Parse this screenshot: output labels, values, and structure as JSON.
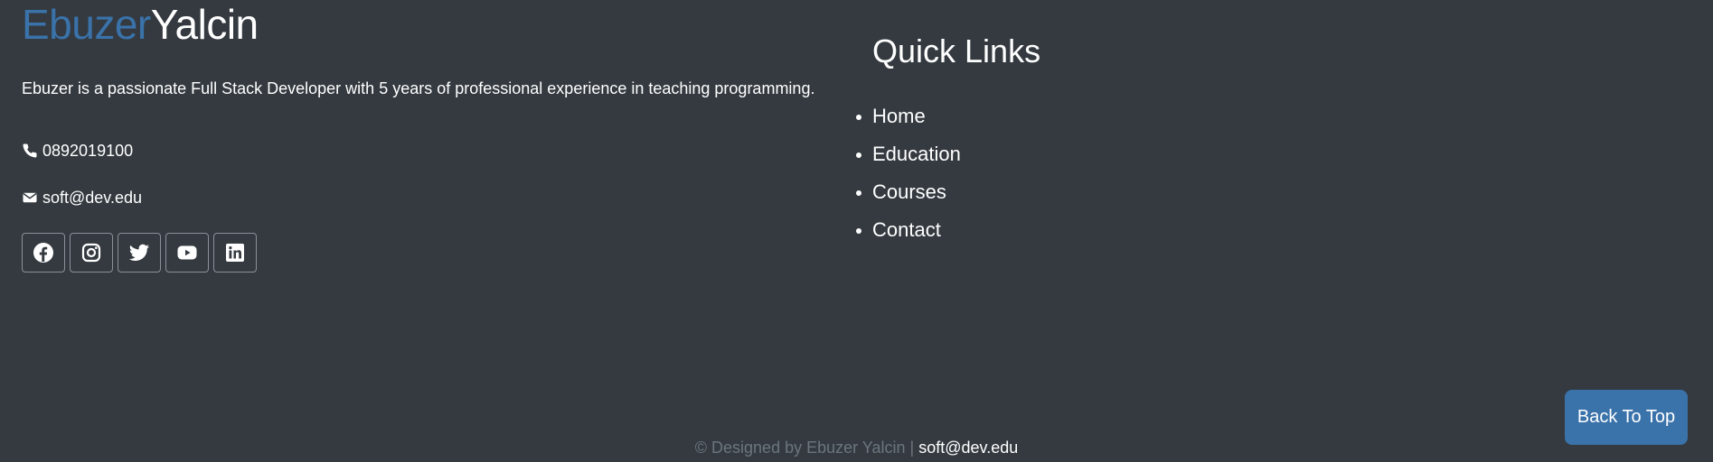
{
  "brand": {
    "first": "Ebuzer",
    "last": "Yalcin"
  },
  "about": "Ebuzer is a passionate Full Stack Developer with 5 years of professional experience in teaching programming.",
  "contact": {
    "phone": "0892019100",
    "email": "soft@dev.edu"
  },
  "socials": [
    {
      "name": "facebook-icon"
    },
    {
      "name": "instagram-icon"
    },
    {
      "name": "twitter-icon"
    },
    {
      "name": "youtube-icon"
    },
    {
      "name": "linkedin-icon"
    }
  ],
  "quick_links": {
    "title": "Quick Links",
    "items": [
      "Home",
      "Education",
      "Courses",
      "Contact"
    ]
  },
  "back_to_top": "Back To Top",
  "footer": {
    "credit": "© Designed by Ebuzer Yalcin",
    "separator": "|",
    "email": "soft@dev.edu"
  },
  "colors": {
    "background": "#343a40",
    "accent": "#3a72aa",
    "muted": "#6c757d"
  }
}
